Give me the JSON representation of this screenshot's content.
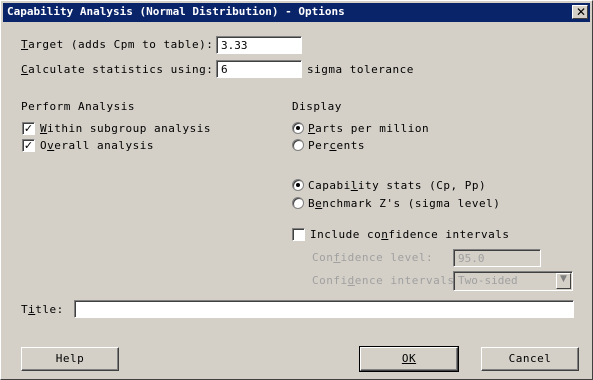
{
  "window": {
    "title": "Capability Analysis (Normal Distribution) - Options",
    "close_glyph": "✕"
  },
  "target": {
    "label_pre": "",
    "label_u": "T",
    "label_post": "arget (adds Cpm to table):",
    "value": "3.33"
  },
  "calc": {
    "label_u": "C",
    "label_post": "alculate statistics using:",
    "value": "6",
    "suffix": "sigma tolerance"
  },
  "perform": {
    "heading": "Perform Analysis",
    "within": {
      "label_u": "W",
      "label_post": "ithin subgroup analysis",
      "checked": "✓"
    },
    "overall": {
      "label_pre": "O",
      "label_u": "v",
      "label_post": "erall analysis",
      "checked": "✓"
    }
  },
  "display": {
    "heading": "Display",
    "ppm": {
      "label_u": "P",
      "label_post": "arts per million"
    },
    "percents": {
      "label_pre": "Per",
      "label_u": "c",
      "label_post": "ents"
    },
    "capstats": {
      "label_pre": "Capabi",
      "label_u": "l",
      "label_post": "ity stats (Cp, Pp)"
    },
    "benchmark": {
      "label_pre": "B",
      "label_u": "e",
      "label_post": "nchmark Z's (sigma level)"
    },
    "include_ci": {
      "label_pre": "Include co",
      "label_u": "n",
      "label_post": "fidence intervals"
    },
    "conf_level": {
      "label_pre": "Con",
      "label_u": "f",
      "label_post": "idence level:",
      "value": "95.0"
    },
    "conf_intervals": {
      "label_pre": "Confi",
      "label_u": "d",
      "label_post": "ence intervals:",
      "value": "Two-sided",
      "arrow": "▼"
    }
  },
  "title_field": {
    "label_pre": "T",
    "label_u": "i",
    "label_post": "tle:",
    "value": ""
  },
  "buttons": {
    "help": "Help",
    "ok": "OK",
    "cancel": "Cancel"
  }
}
